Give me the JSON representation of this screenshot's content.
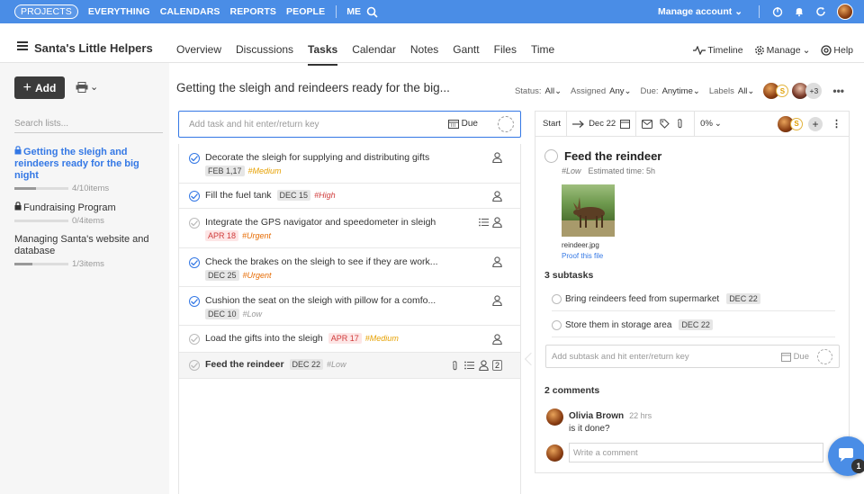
{
  "topnav": {
    "items": [
      "PROJECTS",
      "EVERYTHING",
      "CALENDARS",
      "REPORTS",
      "PEOPLE"
    ],
    "me": "ME",
    "manage_account": "Manage account"
  },
  "project": {
    "title": "Santa's Little Helpers",
    "tabs": [
      "Overview",
      "Discussions",
      "Tasks",
      "Calendar",
      "Notes",
      "Gantt",
      "Files",
      "Time"
    ],
    "active_tab": "Tasks",
    "right": {
      "timeline": "Timeline",
      "manage": "Manage",
      "help": "Help"
    }
  },
  "sidebar": {
    "add_label": "Add",
    "search_placeholder": "Search lists...",
    "lists": [
      {
        "name": "Getting the sleigh and reindeers ready for the big night",
        "count": "4/10items",
        "progress": 0.4,
        "locked": true,
        "active": true
      },
      {
        "name": "Fundraising Program",
        "count": "0/4items",
        "progress": 0.0,
        "locked": true,
        "active": false
      },
      {
        "name": "Managing Santa's website and database",
        "count": "1/3items",
        "progress": 0.33,
        "locked": false,
        "active": false
      }
    ]
  },
  "list": {
    "title": "Getting the sleigh and reindeers ready for the big...",
    "filters": {
      "status_label": "Status:",
      "status_value": "All",
      "assigned_label": "Assigned",
      "assigned_value": "Any",
      "due_label": "Due:",
      "due_value": "Anytime",
      "labels_label": "Labels",
      "labels_value": "All",
      "more_count": "+3"
    },
    "add_placeholder": "Add task and hit enter/return key",
    "due_label": "Due"
  },
  "tasks": [
    {
      "name": "Decorate the sleigh for supplying and distributing gifts",
      "date": "FEB 1,17",
      "date_red": false,
      "tag": "#Medium",
      "tag_class": "medium",
      "done": true
    },
    {
      "name": "Fill the fuel tank",
      "date": "DEC 15",
      "date_red": false,
      "tag": "#High",
      "tag_class": "high",
      "done": true
    },
    {
      "name": "Integrate the GPS navigator and speedometer in sleigh",
      "date": "APR 18",
      "date_red": true,
      "tag": "#Urgent",
      "tag_class": "urgent",
      "done": false
    },
    {
      "name": "Check the brakes on the sleigh to see if they are work...",
      "date": "DEC 25",
      "date_red": false,
      "tag": "#Urgent",
      "tag_class": "urgent",
      "done": true
    },
    {
      "name": "Cushion the seat on the sleigh with pillow for a comfo...",
      "date": "DEC 10",
      "date_red": false,
      "tag": "#Low",
      "tag_class": "low",
      "done": true
    },
    {
      "name": "Load the gifts into the sleigh",
      "date": "APR 17",
      "date_red": true,
      "tag": "#Medium",
      "tag_class": "medium",
      "done": false
    },
    {
      "name": "Feed the reindeer",
      "date": "DEC 22",
      "date_red": false,
      "tag": "#Low",
      "tag_class": "low",
      "done": false,
      "comment_count": "2"
    }
  ],
  "detail": {
    "start_label": "Start",
    "end_date": "Dec 22",
    "percent": "0%",
    "title": "Feed the reindeer",
    "tag": "#Low",
    "estimate": "Estimated time: 5h",
    "file_name": "reindeer.jpg",
    "proof_label": "Proof this file",
    "subtasks_heading": "3 subtasks",
    "subtasks": [
      {
        "name": "Bring reindeers feed from supermarket",
        "date": "DEC 22"
      },
      {
        "name": "Store them in storage area",
        "date": "DEC 22"
      }
    ],
    "add_subtask_placeholder": "Add subtask and hit enter/return key",
    "due_label": "Due",
    "comments_heading": "2 comments",
    "comment": {
      "author": "Olivia Brown",
      "time": "22 hrs",
      "text": "is it done?"
    },
    "write_placeholder": "Write a comment",
    "coin": "S"
  },
  "chat": {
    "badge": "1"
  }
}
